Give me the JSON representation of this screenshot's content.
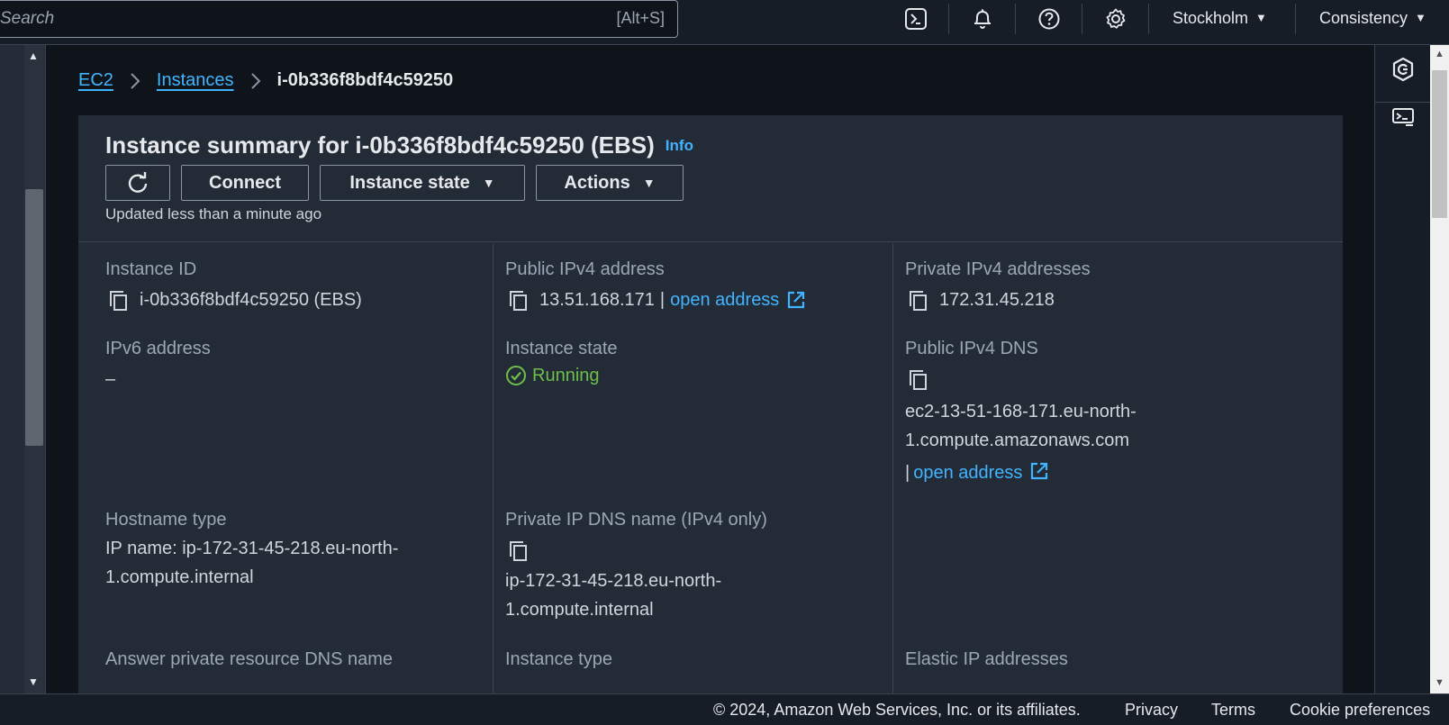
{
  "topbar": {
    "search_placeholder": "Search",
    "search_shortcut": "[Alt+S]",
    "region": "Stockholm",
    "account": "Consistency"
  },
  "icons": {
    "cloudshell": "terminal-icon",
    "notifications": "bell-icon",
    "help": "help-icon",
    "settings": "gear-icon"
  },
  "breadcrumb": {
    "items": [
      "EC2",
      "Instances"
    ],
    "current": "i-0b336f8bdf4c59250"
  },
  "summary": {
    "title": "Instance summary for i-0b336f8bdf4c59250 (EBS)",
    "info": "Info",
    "buttons": {
      "connect": "Connect",
      "instance_state": "Instance state",
      "actions": "Actions"
    },
    "updated": "Updated less than a minute ago"
  },
  "fields": {
    "instance_id": {
      "label": "Instance ID",
      "value": "i-0b336f8bdf4c59250 (EBS)"
    },
    "public_ipv4": {
      "label": "Public IPv4 address",
      "value": "13.51.168.171",
      "sep": "|",
      "link": "open address"
    },
    "private_ipv4": {
      "label": "Private IPv4 addresses",
      "value": "172.31.45.218"
    },
    "ipv6": {
      "label": "IPv6 address",
      "value": "–"
    },
    "instance_state": {
      "label": "Instance state",
      "value": "Running"
    },
    "public_dns": {
      "label": "Public IPv4 DNS",
      "value_line1": "ec2-13-51-168-171.eu-north-",
      "value_line2": "1.compute.amazonaws.com",
      "sep": "|",
      "link": "open address"
    },
    "hostname_type": {
      "label": "Hostname type",
      "value_line1": "IP name: ip-172-31-45-218.eu-north-",
      "value_line2": "1.compute.internal"
    },
    "private_dns": {
      "label": "Private IP DNS name (IPv4 only)",
      "value_line1": "ip-172-31-45-218.eu-north-",
      "value_line2": "1.compute.internal"
    },
    "answer_dns": {
      "label": "Answer private resource DNS name"
    },
    "instance_type": {
      "label": "Instance type"
    },
    "elastic_ip": {
      "label": "Elastic IP addresses"
    }
  },
  "footer": {
    "copyright": "© 2024, Amazon Web Services, Inc. or its affiliates.",
    "privacy": "Privacy",
    "terms": "Terms",
    "cookies": "Cookie preferences"
  },
  "colors": {
    "link": "#42b4ff",
    "running": "#6dbf4a",
    "panel": "#232b36",
    "background": "#0f141a"
  }
}
